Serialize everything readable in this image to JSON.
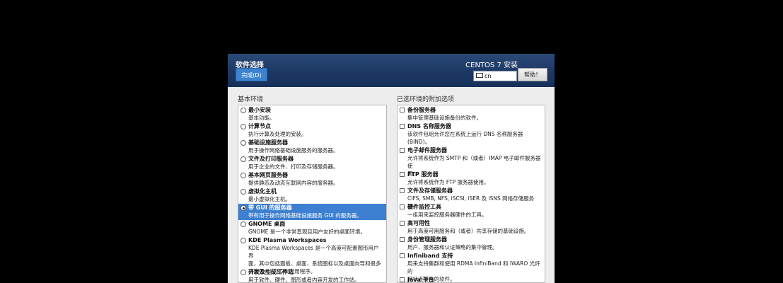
{
  "header": {
    "title": "软件选择",
    "done_label": "完成(D)",
    "product": "CENTOS 7 安装",
    "keyboard": "cn",
    "help_label": "帮助！"
  },
  "base_env": {
    "label": "基本环境",
    "items": [
      {
        "name": "最小安装",
        "desc": "基本功能。"
      },
      {
        "name": "计算节点",
        "desc": "执行计算及处理的安装。"
      },
      {
        "name": "基础设施服务器",
        "desc": "用于操作网络基础设施服务的服务器。"
      },
      {
        "name": "文件及打印服务器",
        "desc": "用于企业的文件、打印及存储服务器。"
      },
      {
        "name": "基本网页服务器",
        "desc": "提供静态及动态互联网内容的服务器。"
      },
      {
        "name": "虚拟化主机",
        "desc": "最小虚拟化主机。"
      },
      {
        "name": "带 GUI 的服务器",
        "desc": "带有用于操作网络基础设施服务 GUI 的服务器。"
      },
      {
        "name": "GNOME 桌面",
        "desc": "GNOME 是一个非常直观且用户友好的桌面环境。"
      },
      {
        "name": "KDE Plasma Workspaces",
        "desc1": "KDE Plasma Workspaces 是一个高度可配置图形用户界",
        "desc2": "面，其中包括面板、桌面、系统图标以及桌面向导和很多",
        "desc3": "功能强大的 KDE 应用程序。"
      },
      {
        "name": "开发及生成工作站",
        "desc": "用于软件、硬件、图形或者内容开发的工作站。"
      }
    ]
  },
  "addons": {
    "label": "已选环境的附加选项",
    "items": [
      {
        "name": "备份服务器",
        "desc": "集中管理基础设施备份的软件。"
      },
      {
        "name": "DNS 名称服务器",
        "desc1": "该软件包组允许您在系统上运行 DNS 名称服务器",
        "desc2": "(BIND)。"
      },
      {
        "name": "电子邮件服务器",
        "desc1": "允许将系统作为 SMTP 和（或者）IMAP 电子邮件服务器使",
        "desc2": "用。"
      },
      {
        "name": "FTP 服务器",
        "desc": "允许将系统作为 FTP 服务器使用。"
      },
      {
        "name": "文件及存储服务器",
        "desc": "CIFS, SMB, NFS, iSCSI, iSER 及 iSNS 网络存储服务器。"
      },
      {
        "name": "硬件监控工具",
        "desc": "一组用来监控服务器硬件的工具。"
      },
      {
        "name": "高可用性",
        "desc": "用于高度可用服务和（或者）共享存储的基础设施。"
      },
      {
        "name": "身份管理服务器",
        "desc": "用户、服务器和认证策略的集中管理。"
      },
      {
        "name": "Infiniband 支持",
        "desc1": "用来支持集群和使用 RDMA InfiniBand 和 iWARO 光纤的",
        "desc2": "网状连接性的软件。"
      },
      {
        "name": "Java 平台",
        "desc": ""
      }
    ]
  }
}
